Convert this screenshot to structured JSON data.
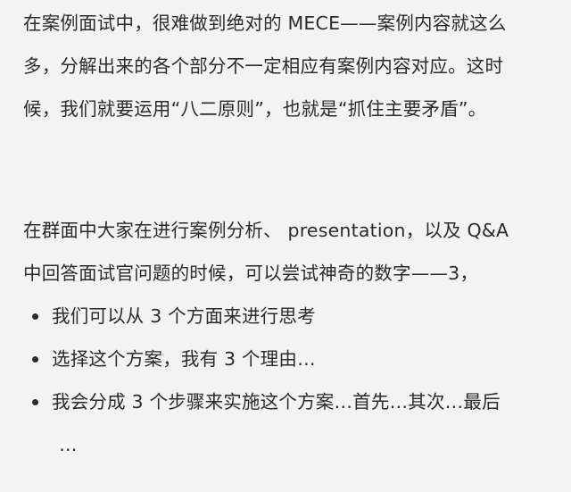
{
  "paragraph1": {
    "lines": [
      "在案例面试中，很难做到绝对的 MECE——案例内容就这么",
      "多，分解出来的各个部分不一定相应有案例内容对应。这时",
      "候，我们就要运用“八二原则”，也就是“抓住主要矛盾”。"
    ]
  },
  "paragraph2": {
    "lines": [
      "在群面中大家在进行案例分析、 presentation，以及 Q&A",
      "中回答面试官问题的时候，可以尝试神奇的数字——3，"
    ]
  },
  "bullets": [
    {
      "lines": [
        "我们可以从 3 个方面来进行思考"
      ]
    },
    {
      "lines": [
        "选择这个方案，我有 3 个理由…"
      ]
    },
    {
      "lines": [
        "我会分成 3 个步骤来实施这个方案…首先…其次…最后",
        "…"
      ]
    }
  ]
}
